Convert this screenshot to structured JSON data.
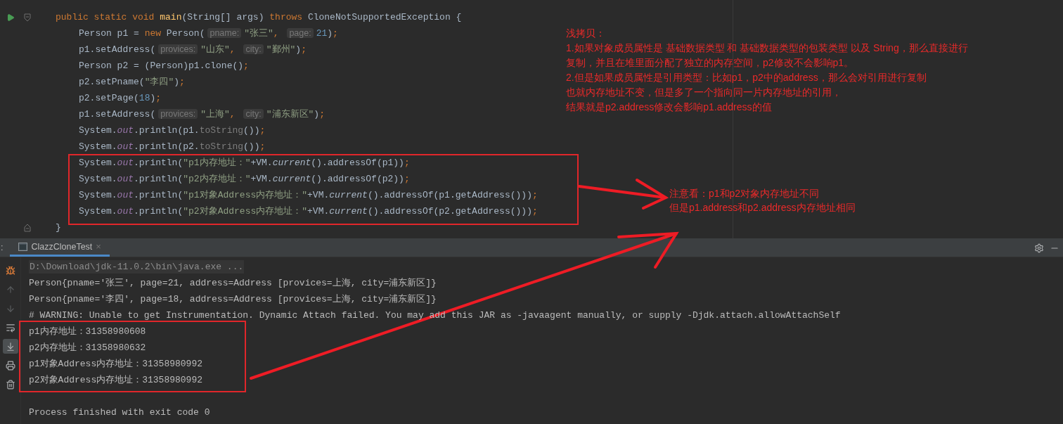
{
  "editor": {
    "code": {
      "signature": [
        {
          "kind": "kw",
          "text": "public static void "
        },
        {
          "kind": "method",
          "text": "main"
        },
        {
          "kind": "plain",
          "text": "(String[] args) "
        },
        {
          "kind": "kw",
          "text": "throws "
        },
        {
          "kind": "plain",
          "text": "CloneNotSupportedException {"
        }
      ],
      "body": [
        {
          "tokens": [
            {
              "kind": "plain",
              "text": "Person p1 = "
            },
            {
              "kind": "kw",
              "text": "new "
            },
            {
              "kind": "plain",
              "text": "Person("
            },
            {
              "kind": "hint",
              "text": "pname:"
            },
            {
              "kind": "str",
              "text": "\"张三\""
            },
            {
              "kind": "semi",
              "text": ", "
            },
            {
              "kind": "hint",
              "text": "page:"
            },
            {
              "kind": "num",
              "text": "21"
            },
            {
              "kind": "plain",
              "text": ")"
            },
            {
              "kind": "semi",
              "text": ";"
            }
          ]
        },
        {
          "tokens": [
            {
              "kind": "plain",
              "text": "p1.setAddress("
            },
            {
              "kind": "hint",
              "text": "provices:"
            },
            {
              "kind": "str",
              "text": "\"山东\""
            },
            {
              "kind": "semi",
              "text": ", "
            },
            {
              "kind": "hint",
              "text": "city:"
            },
            {
              "kind": "str",
              "text": "\"鄞州\""
            },
            {
              "kind": "plain",
              "text": ")"
            },
            {
              "kind": "semi",
              "text": ";"
            }
          ]
        },
        {
          "tokens": [
            {
              "kind": "plain",
              "text": "Person p2 = (Person)p1.clone()"
            },
            {
              "kind": "semi",
              "text": ";"
            }
          ]
        },
        {
          "tokens": [
            {
              "kind": "plain",
              "text": "p2.setPname("
            },
            {
              "kind": "str",
              "text": "\"李四\""
            },
            {
              "kind": "plain",
              "text": ")"
            },
            {
              "kind": "semi",
              "text": ";"
            }
          ]
        },
        {
          "tokens": [
            {
              "kind": "plain",
              "text": "p2.setPage("
            },
            {
              "kind": "num",
              "text": "18"
            },
            {
              "kind": "plain",
              "text": ")"
            },
            {
              "kind": "semi",
              "text": ";"
            }
          ]
        },
        {
          "tokens": [
            {
              "kind": "plain",
              "text": "p1.setAddress("
            },
            {
              "kind": "hint",
              "text": "provices:"
            },
            {
              "kind": "str",
              "text": "\"上海\""
            },
            {
              "kind": "semi",
              "text": ", "
            },
            {
              "kind": "hint",
              "text": "city:"
            },
            {
              "kind": "str",
              "text": "\"浦东新区\""
            },
            {
              "kind": "plain",
              "text": ")"
            },
            {
              "kind": "semi",
              "text": ";"
            }
          ]
        },
        {
          "tokens": [
            {
              "kind": "plain",
              "text": "System."
            },
            {
              "kind": "field",
              "text": "out"
            },
            {
              "kind": "plain",
              "text": ".println(p1."
            },
            {
              "kind": "dim",
              "text": "toString"
            },
            {
              "kind": "plain",
              "text": "())"
            },
            {
              "kind": "semi",
              "text": ";"
            }
          ]
        },
        {
          "tokens": [
            {
              "kind": "plain",
              "text": "System."
            },
            {
              "kind": "field",
              "text": "out"
            },
            {
              "kind": "plain",
              "text": ".println(p2."
            },
            {
              "kind": "dim",
              "text": "toString"
            },
            {
              "kind": "plain",
              "text": "())"
            },
            {
              "kind": "semi",
              "text": ";"
            }
          ]
        },
        {
          "tokens": [
            {
              "kind": "plain",
              "text": "System."
            },
            {
              "kind": "field",
              "text": "out"
            },
            {
              "kind": "plain",
              "text": ".println("
            },
            {
              "kind": "str",
              "text": "\"p1内存地址：\""
            },
            {
              "kind": "plain",
              "text": "+VM."
            },
            {
              "kind": "italic",
              "text": "current"
            },
            {
              "kind": "plain",
              "text": "().addressOf(p1))"
            },
            {
              "kind": "semi",
              "text": ";"
            }
          ]
        },
        {
          "tokens": [
            {
              "kind": "plain",
              "text": "System."
            },
            {
              "kind": "field",
              "text": "out"
            },
            {
              "kind": "plain",
              "text": ".println("
            },
            {
              "kind": "str",
              "text": "\"p2内存地址：\""
            },
            {
              "kind": "plain",
              "text": "+VM."
            },
            {
              "kind": "italic",
              "text": "current"
            },
            {
              "kind": "plain",
              "text": "().addressOf(p2))"
            },
            {
              "kind": "semi",
              "text": ";"
            }
          ]
        },
        {
          "tokens": [
            {
              "kind": "plain",
              "text": "System."
            },
            {
              "kind": "field",
              "text": "out"
            },
            {
              "kind": "plain",
              "text": ".println("
            },
            {
              "kind": "str",
              "text": "\"p1对象Address内存地址：\""
            },
            {
              "kind": "plain",
              "text": "+VM."
            },
            {
              "kind": "italic",
              "text": "current"
            },
            {
              "kind": "plain",
              "text": "().addressOf(p1.getAddress()))"
            },
            {
              "kind": "semi",
              "text": ";"
            }
          ]
        },
        {
          "tokens": [
            {
              "kind": "plain",
              "text": "System."
            },
            {
              "kind": "field",
              "text": "out"
            },
            {
              "kind": "plain",
              "text": ".println("
            },
            {
              "kind": "str",
              "text": "\"p2对象Address内存地址：\""
            },
            {
              "kind": "plain",
              "text": "+VM."
            },
            {
              "kind": "italic",
              "text": "current"
            },
            {
              "kind": "plain",
              "text": "().addressOf(p2.getAddress()))"
            },
            {
              "kind": "semi",
              "text": ";"
            }
          ]
        }
      ],
      "closing": [
        {
          "kind": "plain",
          "text": "}"
        }
      ]
    }
  },
  "console": {
    "panel_label": ":",
    "tab": {
      "label": "ClazzCloneTest",
      "selected": true,
      "close": "×"
    },
    "toolbar": [
      {
        "kind": "bug",
        "selected": false
      },
      {
        "kind": "up",
        "selected": false
      },
      {
        "kind": "down",
        "selected": false
      },
      {
        "kind": "wrap",
        "selected": false
      },
      {
        "kind": "scroll-end",
        "selected": true
      },
      {
        "kind": "print",
        "selected": false
      },
      {
        "kind": "trash",
        "selected": false
      }
    ],
    "lines": [
      {
        "kind": "command",
        "text": "D:\\Download\\jdk-11.0.2\\bin\\java.exe ..."
      },
      {
        "kind": "output",
        "text": "Person{pname='张三', page=21, address=Address [provices=上海, city=浦东新区]}"
      },
      {
        "kind": "output",
        "text": "Person{pname='李四', page=18, address=Address [provices=上海, city=浦东新区]}"
      },
      {
        "kind": "output",
        "text": "# WARNING: Unable to get Instrumentation. Dynamic Attach failed. You may add this JAR as -javaagent manually, or supply -Djdk.attach.allowAttachSelf"
      },
      {
        "kind": "output",
        "text": "p1内存地址：31358980608"
      },
      {
        "kind": "output",
        "text": "p2内存地址：31358980632"
      },
      {
        "kind": "output",
        "text": "p1对象Address内存地址：31358980992"
      },
      {
        "kind": "output",
        "text": "p2对象Address内存地址：31358980992"
      },
      {
        "kind": "blank"
      },
      {
        "kind": "output",
        "text": "Process finished with exit code 0"
      }
    ]
  },
  "notes": [
    {
      "lines": [
        "浅拷贝：",
        "1.如果对象成员属性是 基础数据类型 和 基础数据类型的包装类型 以及 String，那么直接进行",
        "复制，并且在堆里面分配了独立的内存空间，p2修改不会影响p1。",
        "2.但是如果成员属性是引用类型：比如p1，p2中的address，那么会对引用进行复制",
        "也就内存地址不变，但是多了一个指向同一片内存地址的引用，",
        "结果就是p2.address修改会影响p1.address的值"
      ]
    },
    {
      "lines": [
        "注意看：p1和p2对象内存地址不同",
        "但是p1.address和p2.address内存地址相同"
      ]
    }
  ]
}
